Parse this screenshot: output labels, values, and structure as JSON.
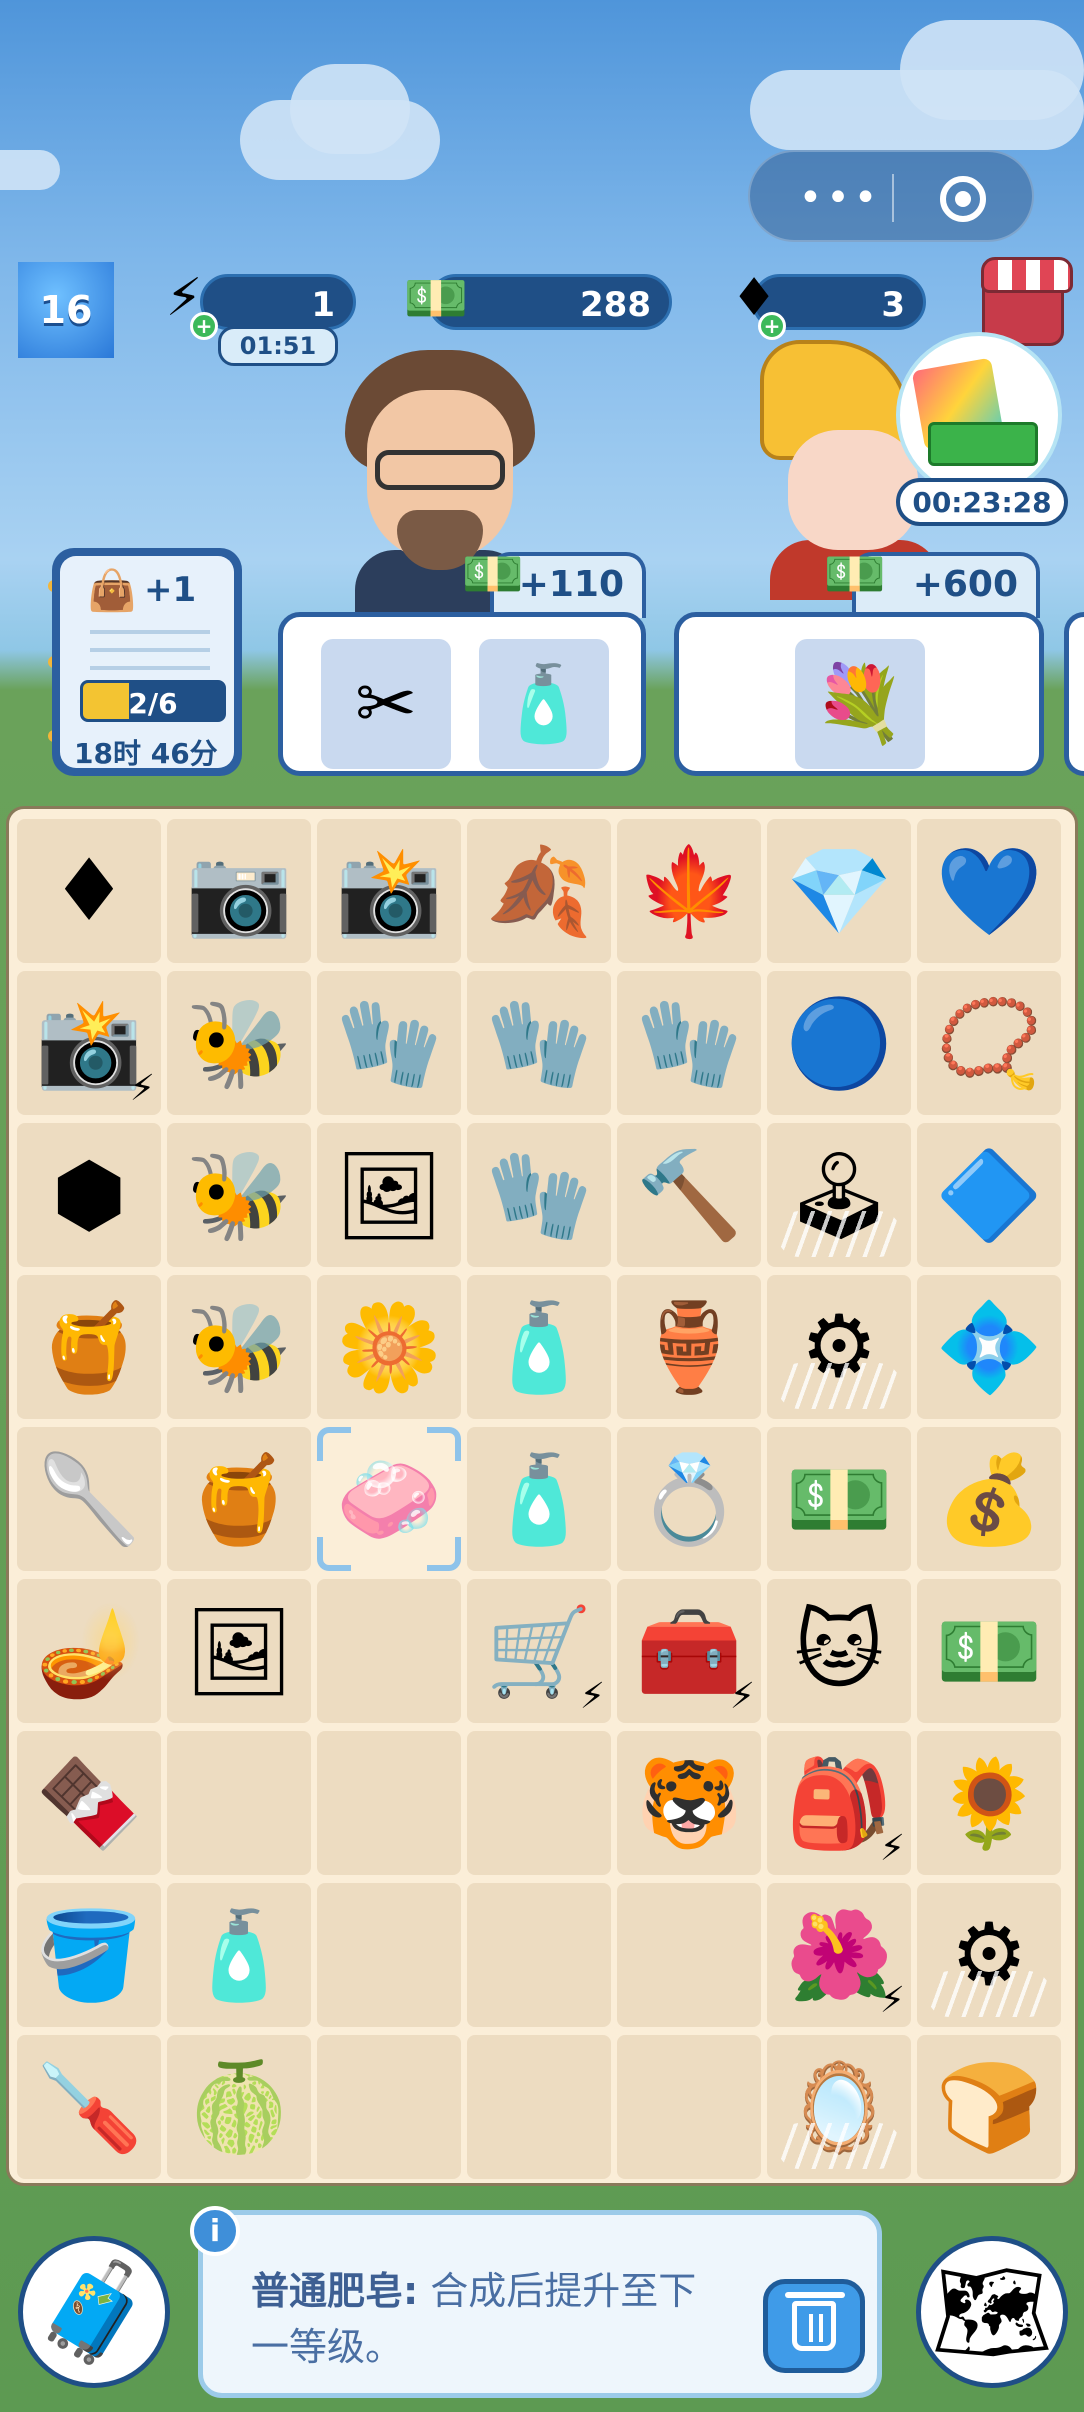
{
  "hud": {
    "level": "16",
    "energy": "1",
    "energy_timer": "01:51",
    "cash": "288",
    "gems": "3",
    "gift_timer": "00:23:28"
  },
  "task": {
    "reward": "+1",
    "progress": "2/6",
    "progress_fraction": 0.33,
    "time_left": "18时 46分"
  },
  "orders": [
    {
      "reward": "+110",
      "items": [
        "pruning-shears",
        "lotion-bottle"
      ]
    },
    {
      "reward": "+600",
      "items": [
        "flower-bouquet"
      ]
    }
  ],
  "board": {
    "rows": [
      [
        "two-red-gems",
        "compact-camera",
        "dslr-camera",
        "leaf-sticker-pack",
        "leaf-sticker",
        "gem-bracelet",
        "heart-gem-bracelet"
      ],
      [
        "camera-generator",
        "bee-hive-generator",
        "white-glove",
        "white-glove-pair",
        "red-work-gloves",
        "crystal-pendant",
        "beaded-bracelet"
      ],
      [
        "honeycomb-cell",
        "bee-with-flower",
        "baby-photo-sketch",
        "red-gloves-bundle",
        "trowel",
        "webbed-lever-machine",
        "blue-gem-pendant"
      ],
      [
        "honey-jar",
        "bee",
        "bee-with-honey-flower",
        "lotion-bottle",
        "porcelain-vase",
        "webbed-press-machine",
        "crystal-earring"
      ],
      [
        "honey-dipper",
        "honey-bowl",
        "soap-bar",
        "pink-lotion-bottle",
        "silver-ring",
        "cash-bundle",
        "cash-pile"
      ],
      [
        "oil-lamp",
        "baby-photo-frame",
        "",
        "shopping-cart-generator",
        "toolbox-generator",
        "lucky-cat",
        "cash-stack"
      ],
      [
        "chocolate-bar",
        "",
        "",
        "",
        "tiger-fortune",
        "bunny-backpack",
        "potted-flowers"
      ],
      [
        "mop-bucket",
        "shampoo-bottle",
        "",
        "",
        "",
        "flower-bush",
        "webbed-press-machine-2"
      ],
      [
        "green-screwdriver",
        "melon-ball",
        "",
        "",
        "",
        "webbed-mirror",
        "bread-loaf"
      ]
    ],
    "selected": "soap-bar"
  },
  "info": {
    "item_name": "普通肥皂:",
    "description": " 合成后提升至下一等级。"
  },
  "icons": {
    "menu": "more-dots-icon",
    "close": "target-icon"
  }
}
